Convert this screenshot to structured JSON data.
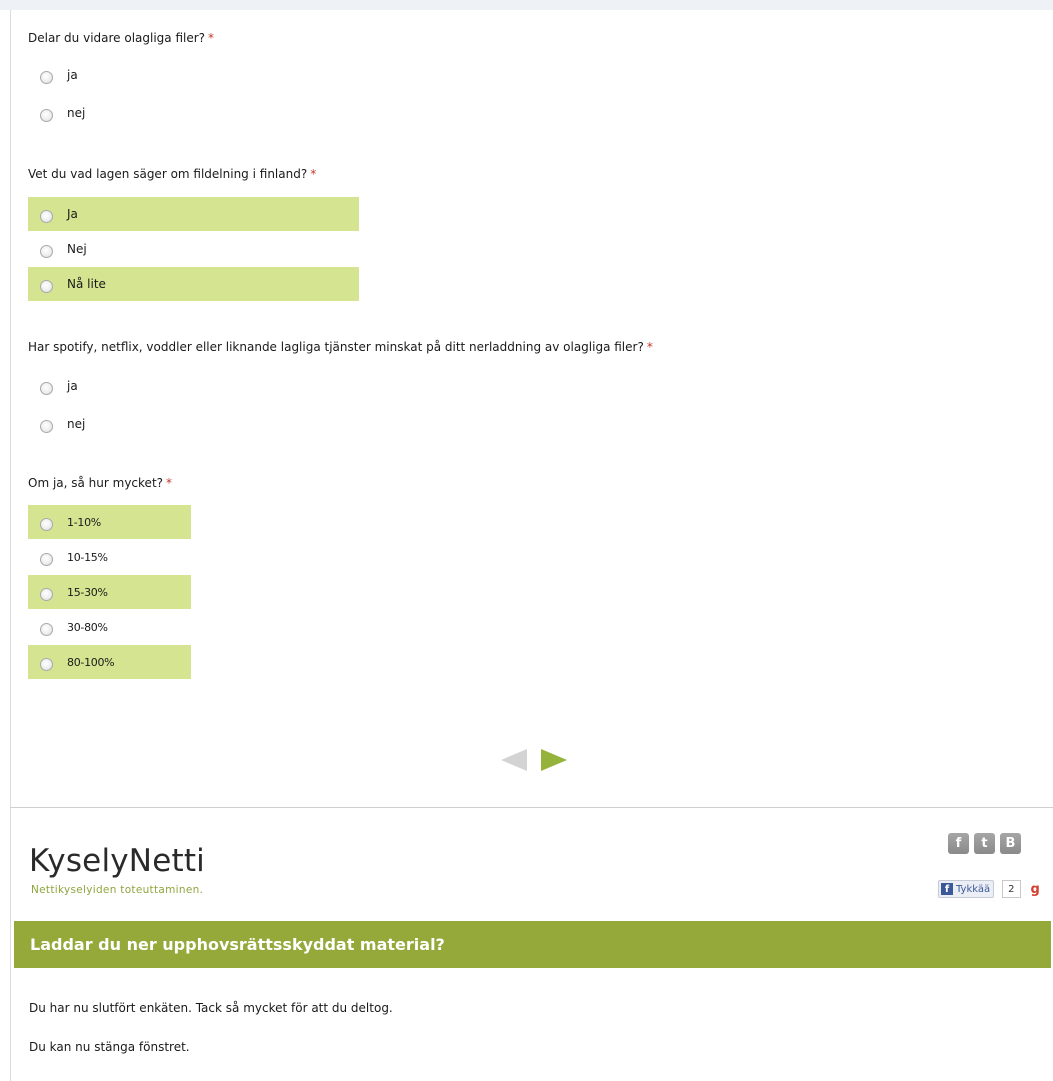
{
  "questions": [
    {
      "text": "Delar du vidare olagliga filer?",
      "required_marker": "*",
      "options": [
        {
          "label": "ja",
          "highlighted": false
        },
        {
          "label": "nej",
          "highlighted": false
        }
      ]
    },
    {
      "text": "Vet du vad lagen säger om fildelning i finland?",
      "required_marker": "*",
      "options": [
        {
          "label": "Ja",
          "highlighted": true
        },
        {
          "label": "Nej",
          "highlighted": false
        },
        {
          "label": "Nå lite",
          "highlighted": true
        }
      ]
    },
    {
      "text": "Har spotify, netflix, voddler eller liknande lagliga tjänster minskat på ditt nerladdning av olagliga filer?",
      "required_marker": "*",
      "options": [
        {
          "label": "ja",
          "highlighted": false
        },
        {
          "label": "nej",
          "highlighted": false
        }
      ]
    },
    {
      "text": "Om ja, så hur mycket?",
      "required_marker": "*",
      "options": [
        {
          "label": "1-10%",
          "highlighted": true
        },
        {
          "label": "10-15%",
          "highlighted": false
        },
        {
          "label": "15-30%",
          "highlighted": true
        },
        {
          "label": "30-80%",
          "highlighted": false
        },
        {
          "label": "80-100%",
          "highlighted": true
        }
      ]
    }
  ],
  "brand": {
    "name": "KyselyNetti",
    "tagline": "Nettikyselyiden toteuttaminen."
  },
  "social": {
    "buttons": [
      "f",
      "t",
      "B"
    ],
    "like_label": "Tykkää",
    "like_count": "2",
    "gplus_label": "g"
  },
  "survey": {
    "title": "Laddar du ner upphovsrättsskyddat material?",
    "completed_message": "Du har nu slutfört enkäten. Tack så mycket för att du deltog.",
    "close_message": "Du kan nu stänga fönstret."
  },
  "colors": {
    "highlight": "#d5e490",
    "brand_green": "#95a93b",
    "next_arrow": "#95b23a",
    "prev_arrow": "#d3d3d3",
    "required": "#c0392b"
  }
}
